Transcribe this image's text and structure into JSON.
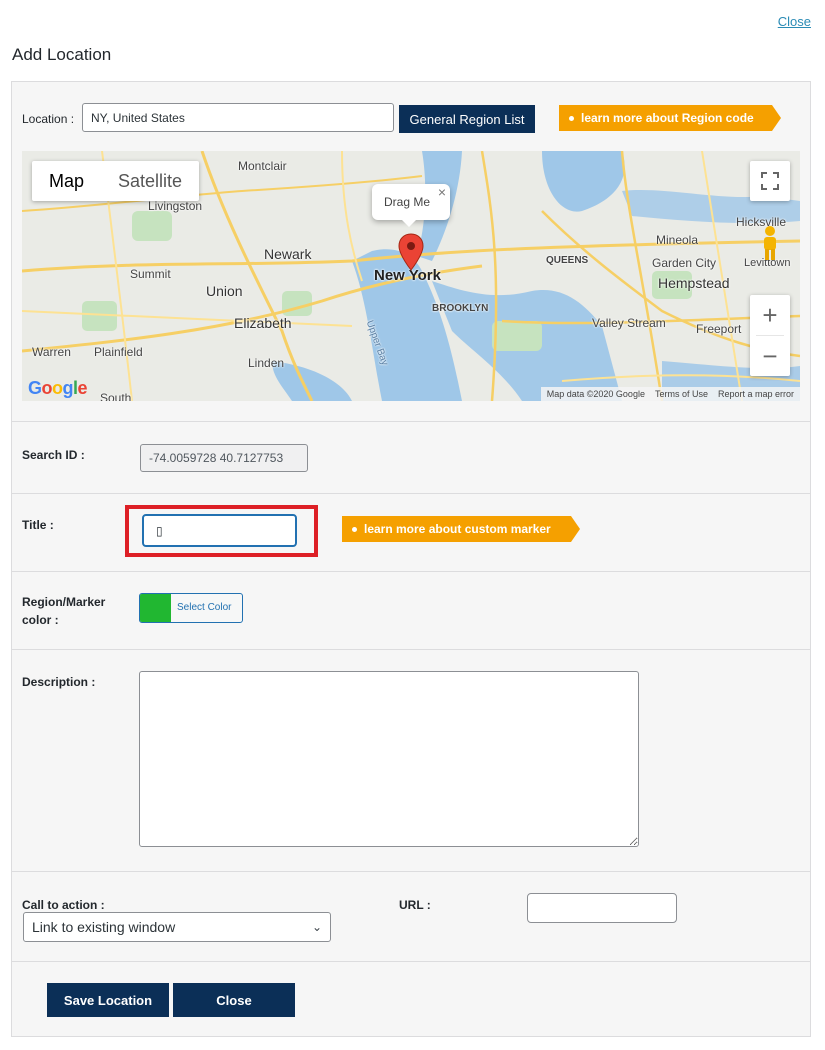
{
  "top_close": "Close",
  "page_title": "Add Location",
  "location": {
    "label": "Location :",
    "value": "NY, United States",
    "region_list_button": "General Region List",
    "region_code_tag": "learn more about Region code"
  },
  "map": {
    "type_map": "Map",
    "type_satellite": "Satellite",
    "marker_popup": "Drag Me",
    "attribution": [
      "Map data ©2020 Google",
      "Terms of Use",
      "Report a map error"
    ],
    "logo": "Google",
    "cities": [
      "Montclair",
      "Livingston",
      "Newark",
      "New York",
      "Union",
      "Elizabeth",
      "Summit",
      "Linden",
      "Warren",
      "Plainfield",
      "South",
      "BROOKLYN",
      "QUEENS",
      "Mineola",
      "Garden City",
      "Hempstead",
      "Valley Stream",
      "Freeport",
      "Hicksville",
      "Levittown",
      "Upper Bay"
    ]
  },
  "search": {
    "label": "Search ID :",
    "value": "-74.0059728 40.7127753"
  },
  "title": {
    "label": "Title :",
    "value": "▯",
    "marker_tag": "learn more about custom marker"
  },
  "color": {
    "label": "Region/Marker color :",
    "button_label": "Select Color",
    "swatch": "#21b731"
  },
  "description": {
    "label": "Description :"
  },
  "cta": {
    "label": "Call to action :",
    "selected": "Link to existing window",
    "url_label": "URL :"
  },
  "actions": {
    "save": "Save Location",
    "close": "Close"
  }
}
